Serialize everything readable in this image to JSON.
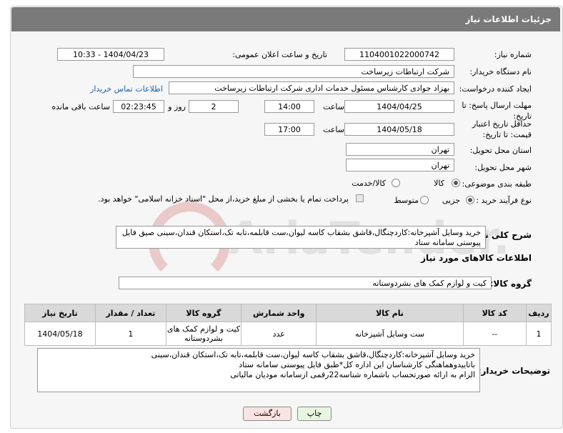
{
  "header": {
    "title": "جزئیات اطلاعات نیاز"
  },
  "fields": {
    "need_number": {
      "label": "شماره نیاز:",
      "value": "1104001022000742"
    },
    "announce_datetime": {
      "label": "تاریخ و ساعت اعلان عمومی:",
      "value": "1404/04/23 - 10:33"
    },
    "buyer_org": {
      "label": "نام دستگاه خریدار:",
      "value": "شرکت ارتباطات زیرساخت"
    },
    "requester": {
      "label": "ایجاد کننده درخواست:",
      "value": "بهزاد جوادی کارشناس مسئول خدمات اداری شرکت ارتباطات زیرساخت",
      "contact_link": "اطلاعات تماس خریدار"
    },
    "reply_deadline": {
      "label": "مهلت ارسال پاسخ: تا تاریخ:",
      "date": "1404/04/25",
      "time_label": "ساعت",
      "time": "14:00",
      "days": "2",
      "days_label": "روز و",
      "remaining": "02:23:45",
      "remaining_label": "ساعت باقی مانده"
    },
    "price_validity": {
      "label": "حداقل تاریخ اعتبار قیمت: تا تاریخ:",
      "date": "1404/05/18",
      "time_label": "ساعت",
      "time": "17:00"
    },
    "delivery_province": {
      "label": "استان محل تحویل:",
      "value": "تهران"
    },
    "delivery_city": {
      "label": "شهر محل تحویل:",
      "value": "تهران"
    },
    "category": {
      "label": "طبقه بندی موضوعی:",
      "options": [
        "کالا",
        "کالا/خدمت"
      ],
      "selected": "کالا"
    },
    "purchase_process": {
      "label": "نوع فرآیند خرید :",
      "options": [
        "جزیی",
        "متوسط"
      ],
      "selected": "جزیی",
      "note": "پرداخت تمام یا بخشی از مبلغ خرید،از محل \"اسناد خزانه اسلامی\" خواهد بود."
    },
    "general_desc": {
      "label": "شرح کلی نیاز:",
      "value": "خرید وسایل آشپزخانه:کاردچنگال،قاشق بشقاب کاسه لیوان،ست قابلمه،تابه تک،استکان قندان،سینی صیق فایل پیوستی سامانه ستاد"
    }
  },
  "goods": {
    "section_title": "اطلاعات کالاهای مورد نیاز",
    "group_label": "گروه کالا:",
    "group_value": "کیت و لوازم کمک های بشردوستانه",
    "columns": [
      "ردیف",
      "کد کالا",
      "نام کالا",
      "واحد شمارش",
      "گروه کالا",
      "تعداد / مقدار",
      "تاریخ نیاز"
    ],
    "rows": [
      {
        "index": "1",
        "code": "--",
        "name": "ست وسایل آشپزخانه",
        "unit": "عدد",
        "group": "کیت و لوازم کمک های بشردوستانه",
        "qty": "1",
        "date": "1404/05/18"
      }
    ]
  },
  "buyer_notes": {
    "label": "توضیحات خریدار:",
    "lines": [
      "خرید وسایل آشپزخانه:کاردچنگال،قاشق بشقاب کاسه لیوان،ست قابلمه،تابه تک،استکان قندان،سینی",
      "باتاییدوهماهنگی کارشناسان این اداره کل*طبق فایل پیوستی سامانه ستاد",
      "الزام به ارائه صورتحساب باشماره شناسه22رقمی ازسامانه مودیان مالیاتی"
    ]
  },
  "buttons": {
    "print": "چاپ",
    "back": "بازگشت"
  },
  "watermark": {
    "text": "AriaTender.net"
  },
  "colors": {
    "header_bg": "#7a7a7a",
    "link": "#1b5fb0",
    "print_btn": "#e8f6e0",
    "back_btn": "#fbe3e3"
  }
}
